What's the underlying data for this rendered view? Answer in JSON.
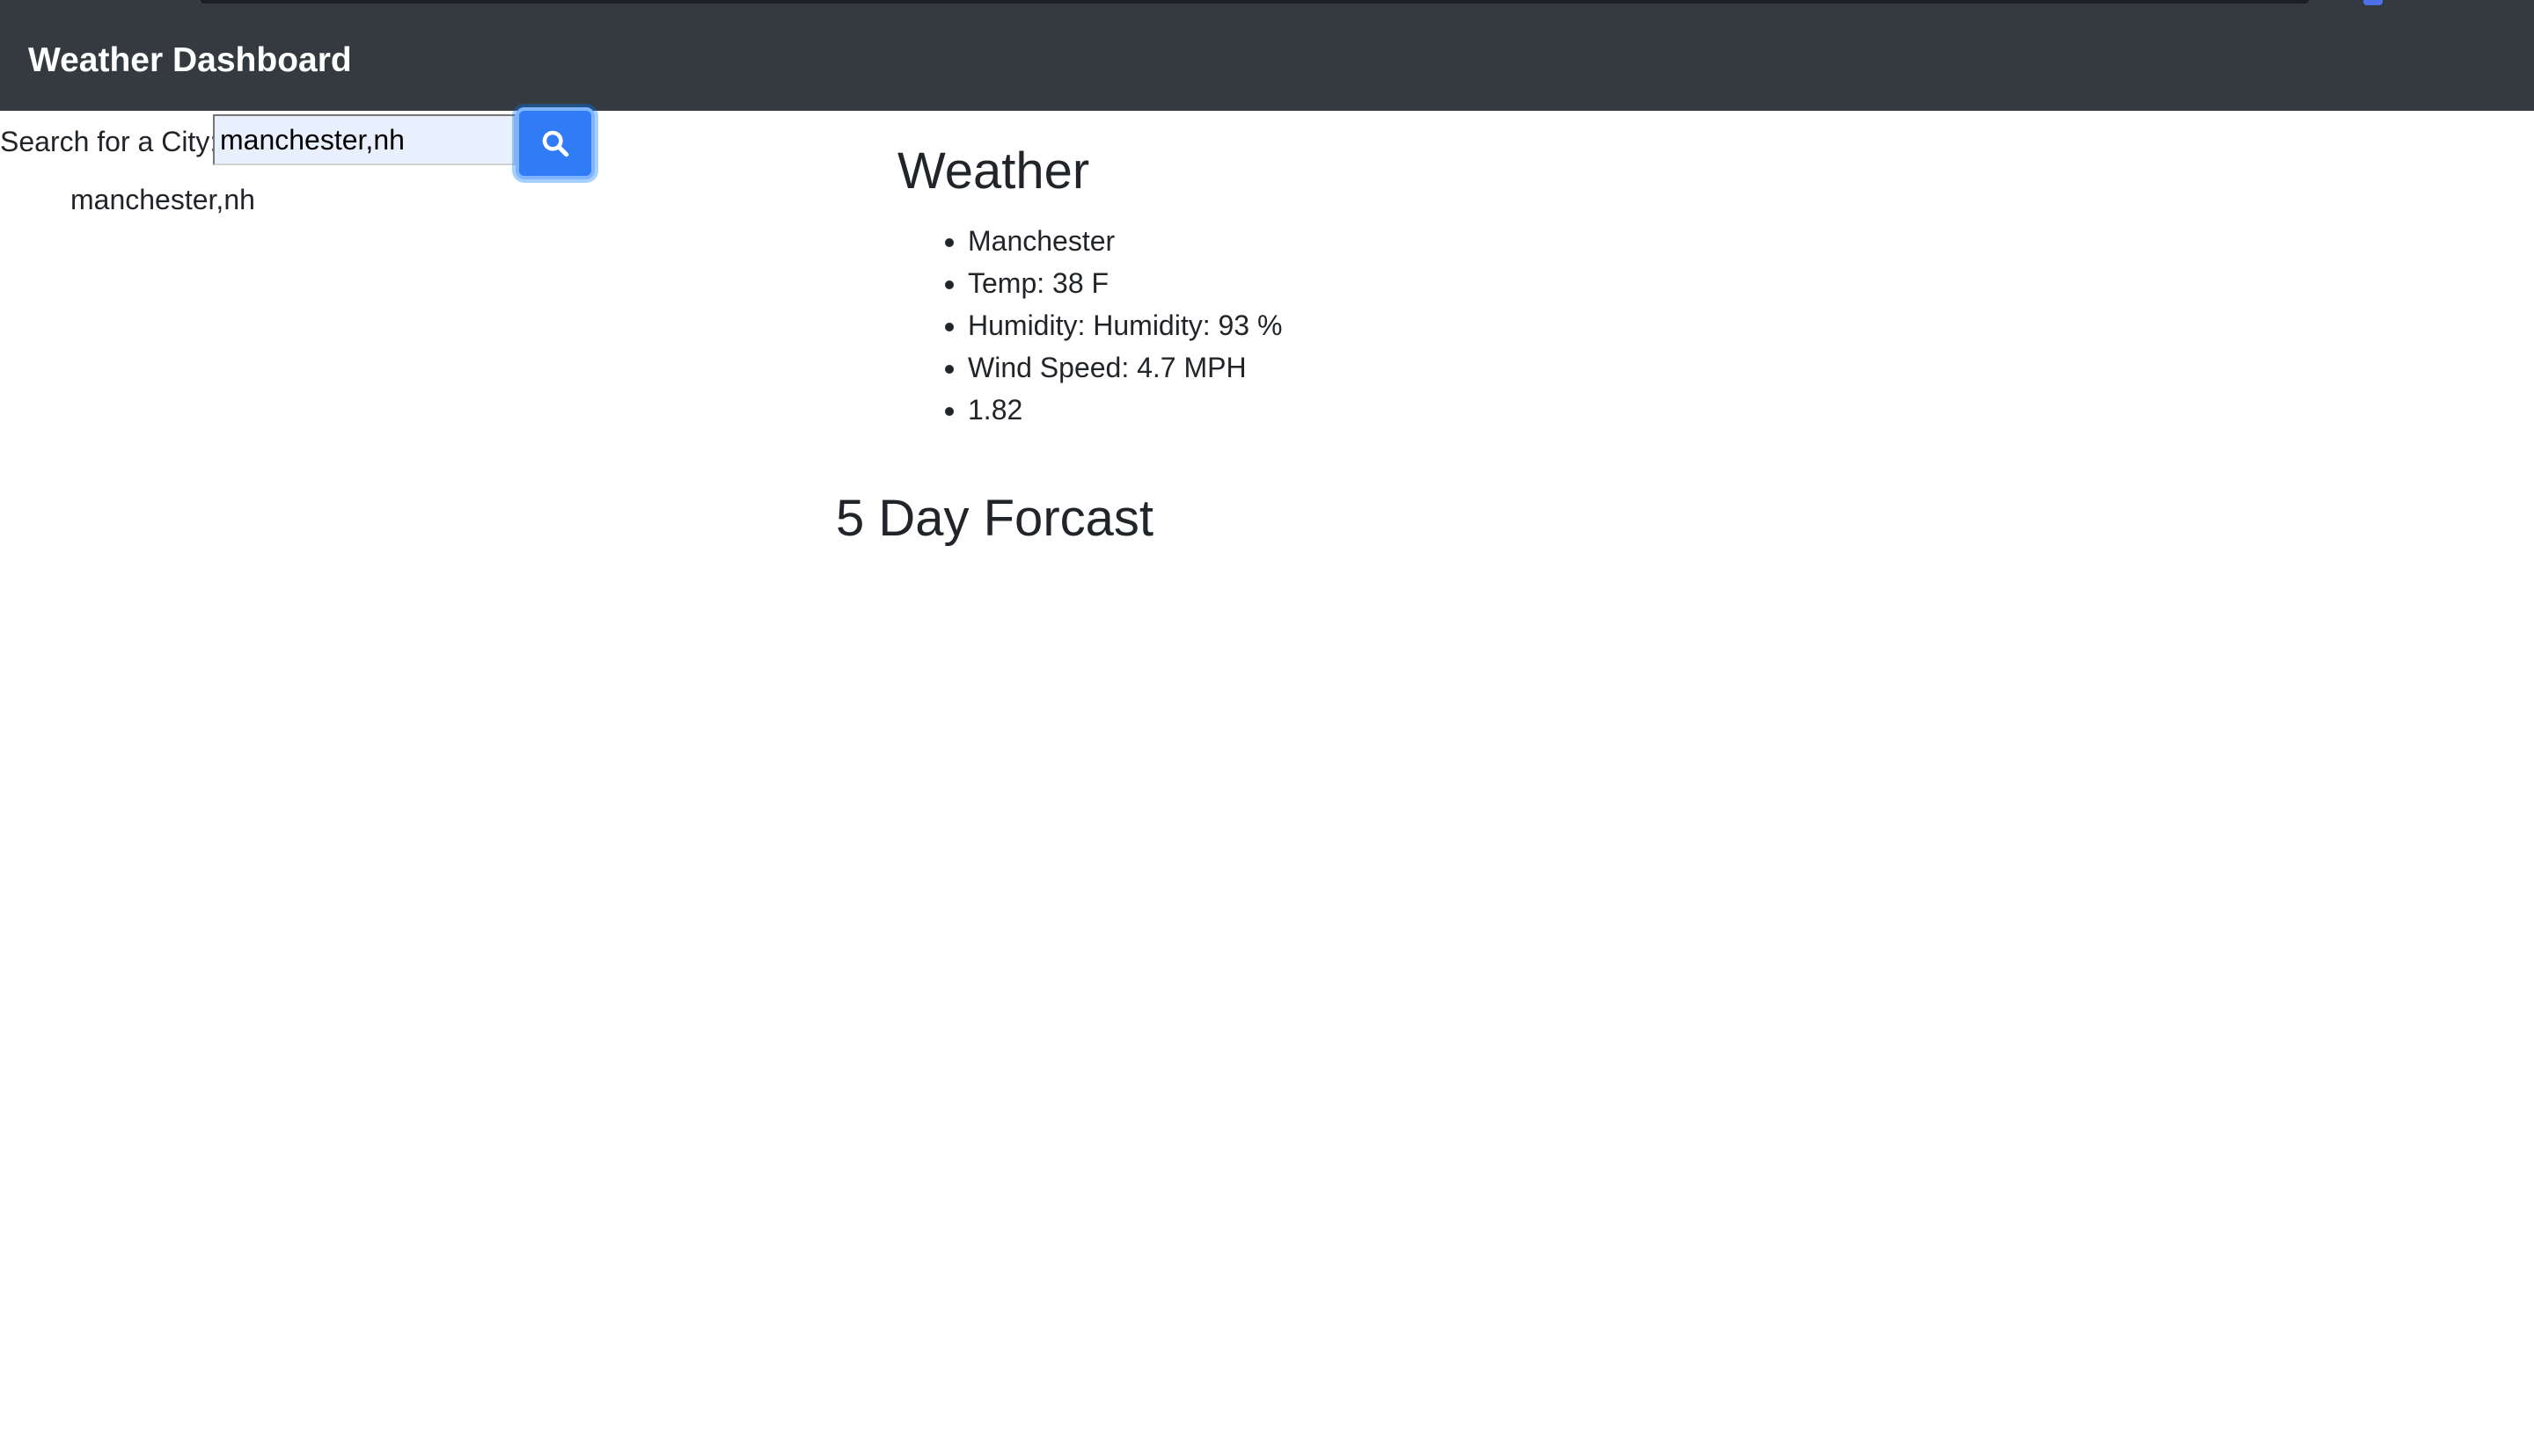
{
  "navbar": {
    "brand": "Weather Dashboard"
  },
  "search": {
    "label": "Search for a City:",
    "value": "manchester,nh",
    "button_icon": "search-icon"
  },
  "history": {
    "items": [
      "manchester,nh"
    ]
  },
  "current": {
    "title": "Weather",
    "city": "Manchester",
    "temp": "Temp: 38 F",
    "humidity": "Humidity: Humidity: 93 %",
    "wind": "Wind Speed: 4.7 MPH",
    "uv": "1.82"
  },
  "forecast": {
    "title": "5 Day Forcast"
  },
  "colors": {
    "navbar_bg": "#343a40",
    "button_bg": "#2f7cf6",
    "input_autofill_bg": "#e8f0fe"
  }
}
